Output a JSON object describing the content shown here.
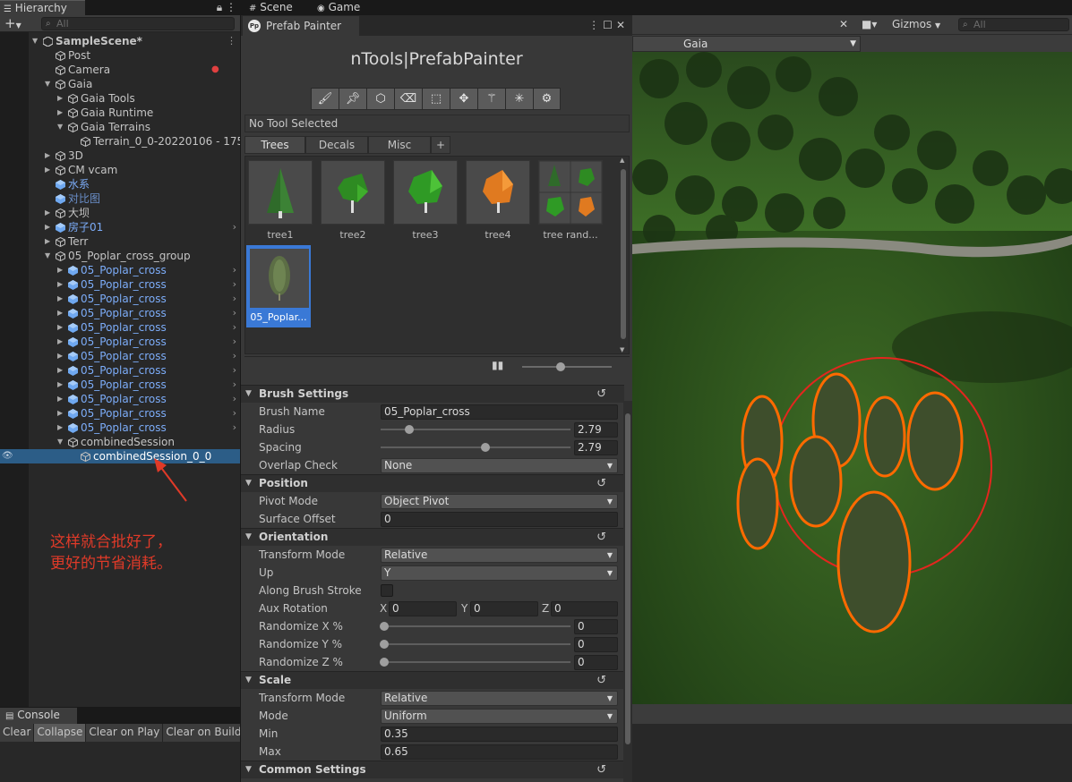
{
  "hierarchy": {
    "tab_label": "Hierarchy",
    "add_label": "+",
    "search_placeholder": "All",
    "items": [
      {
        "label": "SampleScene*",
        "depth": 0,
        "icon": "unity-scene-icon",
        "expanded": true,
        "style": "scene"
      },
      {
        "label": "Post",
        "depth": 1,
        "icon": "gameobject-icon",
        "style": "normal"
      },
      {
        "label": "Camera",
        "depth": 1,
        "icon": "gameobject-icon",
        "style": "normal"
      },
      {
        "label": "Gaia",
        "depth": 1,
        "icon": "gameobject-icon",
        "expanded": true,
        "style": "normal"
      },
      {
        "label": "Gaia Tools",
        "depth": 2,
        "icon": "gameobject-icon",
        "collapsed": true,
        "style": "normal"
      },
      {
        "label": "Gaia Runtime",
        "depth": 2,
        "icon": "gameobject-icon",
        "collapsed": true,
        "style": "normal"
      },
      {
        "label": "Gaia Terrains",
        "depth": 2,
        "icon": "gameobject-icon",
        "expanded": true,
        "style": "normal"
      },
      {
        "label": "Terrain_0_0-20220106 - 175",
        "depth": 3,
        "icon": "gameobject-icon",
        "style": "normal"
      },
      {
        "label": "3D",
        "depth": 1,
        "icon": "gameobject-icon",
        "collapsed": true,
        "style": "normal"
      },
      {
        "label": "CM vcam",
        "depth": 1,
        "icon": "gameobject-icon",
        "collapsed": true,
        "style": "normal"
      },
      {
        "label": "水系",
        "depth": 1,
        "icon": "prefab-icon",
        "style": "blue"
      },
      {
        "label": "对比图",
        "depth": 1,
        "icon": "prefab-icon",
        "style": "faint"
      },
      {
        "label": "大坝",
        "depth": 1,
        "icon": "gameobject-icon",
        "collapsed": true,
        "style": "normal"
      },
      {
        "label": "房子01",
        "depth": 1,
        "icon": "prefab-icon",
        "collapsed": true,
        "style": "blue",
        "more": true
      },
      {
        "label": "Terr",
        "depth": 1,
        "icon": "gameobject-icon",
        "collapsed": true,
        "style": "normal"
      },
      {
        "label": "05_Poplar_cross_group",
        "depth": 1,
        "icon": "gameobject-icon",
        "expanded": true,
        "style": "normal"
      },
      {
        "label": "05_Poplar_cross",
        "depth": 2,
        "icon": "prefab-icon",
        "collapsed": true,
        "style": "blue",
        "more": true
      },
      {
        "label": "05_Poplar_cross",
        "depth": 2,
        "icon": "prefab-icon",
        "collapsed": true,
        "style": "blue",
        "more": true
      },
      {
        "label": "05_Poplar_cross",
        "depth": 2,
        "icon": "prefab-icon",
        "collapsed": true,
        "style": "blue",
        "more": true
      },
      {
        "label": "05_Poplar_cross",
        "depth": 2,
        "icon": "prefab-icon",
        "collapsed": true,
        "style": "blue",
        "more": true
      },
      {
        "label": "05_Poplar_cross",
        "depth": 2,
        "icon": "prefab-icon",
        "collapsed": true,
        "style": "blue",
        "more": true
      },
      {
        "label": "05_Poplar_cross",
        "depth": 2,
        "icon": "prefab-icon",
        "collapsed": true,
        "style": "blue",
        "more": true
      },
      {
        "label": "05_Poplar_cross",
        "depth": 2,
        "icon": "prefab-icon",
        "collapsed": true,
        "style": "blue",
        "more": true
      },
      {
        "label": "05_Poplar_cross",
        "depth": 2,
        "icon": "prefab-icon",
        "collapsed": true,
        "style": "blue",
        "more": true
      },
      {
        "label": "05_Poplar_cross",
        "depth": 2,
        "icon": "prefab-icon",
        "collapsed": true,
        "style": "blue",
        "more": true
      },
      {
        "label": "05_Poplar_cross",
        "depth": 2,
        "icon": "prefab-icon",
        "collapsed": true,
        "style": "blue",
        "more": true
      },
      {
        "label": "05_Poplar_cross",
        "depth": 2,
        "icon": "prefab-icon",
        "collapsed": true,
        "style": "blue",
        "more": true
      },
      {
        "label": "05_Poplar_cross",
        "depth": 2,
        "icon": "prefab-icon",
        "collapsed": true,
        "style": "blue",
        "more": true
      },
      {
        "label": "combinedSession",
        "depth": 2,
        "icon": "gameobject-icon",
        "expanded": true,
        "style": "normal"
      },
      {
        "label": "combinedSession_0_0",
        "depth": 3,
        "icon": "gameobject-icon",
        "style": "selected"
      }
    ],
    "annotation_lines": [
      "这样就合批好了，",
      "更好的节省消耗。"
    ]
  },
  "console": {
    "tab_label": "Console",
    "buttons": [
      "Clear",
      "Collapse",
      "Clear on Play",
      "Clear on Build"
    ]
  },
  "prefab_painter": {
    "tab_label": "Prefab Painter",
    "title": "nTools|PrefabPainter",
    "tool_icons": [
      "brush-icon",
      "pin-icon",
      "cube-icon",
      "eraser-icon",
      "select-icon",
      "move-icon",
      "magic-wand-icon",
      "scatter-icon",
      "settings-icon"
    ],
    "status": "No Tool Selected",
    "tabs": [
      "Trees",
      "Decals",
      "Misc"
    ],
    "add_tab_label": "+",
    "prefabs": [
      {
        "label": "tree1",
        "color": "#2f6b2a"
      },
      {
        "label": "tree2",
        "color": "#2e8b22"
      },
      {
        "label": "tree3",
        "color": "#2f9a25"
      },
      {
        "label": "tree4",
        "color": "#e07a20"
      },
      {
        "label": "tree rand...",
        "color": "#3a8a2a"
      },
      {
        "label": "05_Poplar...",
        "color": "#5c6e45",
        "selected": true
      }
    ],
    "brush_settings": {
      "header": "Brush Settings",
      "brush_name_label": "Brush Name",
      "brush_name": "05_Poplar_cross",
      "radius_label": "Radius",
      "radius": "2.79",
      "spacing_label": "Spacing",
      "spacing": "2.79",
      "overlap_label": "Overlap Check",
      "overlap": "None"
    },
    "position": {
      "header": "Position",
      "pivot_label": "Pivot Mode",
      "pivot": "Object Pivot",
      "offset_label": "Surface Offset",
      "offset": "0"
    },
    "orientation": {
      "header": "Orientation",
      "transform_label": "Transform Mode",
      "transform": "Relative",
      "up_label": "Up",
      "up": "Y",
      "along_label": "Along Brush Stroke",
      "aux_label": "Aux Rotation",
      "aux_x": "0",
      "aux_y": "0",
      "aux_z": "0",
      "rand_x_label": "Randomize X %",
      "rand_x": "0",
      "rand_y_label": "Randomize Y %",
      "rand_y": "0",
      "rand_z_label": "Randomize Z %",
      "rand_z": "0"
    },
    "scale": {
      "header": "Scale",
      "transform_label": "Transform Mode",
      "transform": "Relative",
      "mode_label": "Mode",
      "mode": "Uniform",
      "min_label": "Min",
      "min": "0.35",
      "max_label": "Max",
      "max": "0.65"
    },
    "common": {
      "header": "Common Settings"
    },
    "axis_letters": {
      "x": "X",
      "y": "Y",
      "z": "Z"
    }
  },
  "scene": {
    "scene_tab": "Scene",
    "game_tab": "Game",
    "gizmos_label": "Gizmos",
    "search_placeholder": "All",
    "camera_label": "Gaia"
  }
}
